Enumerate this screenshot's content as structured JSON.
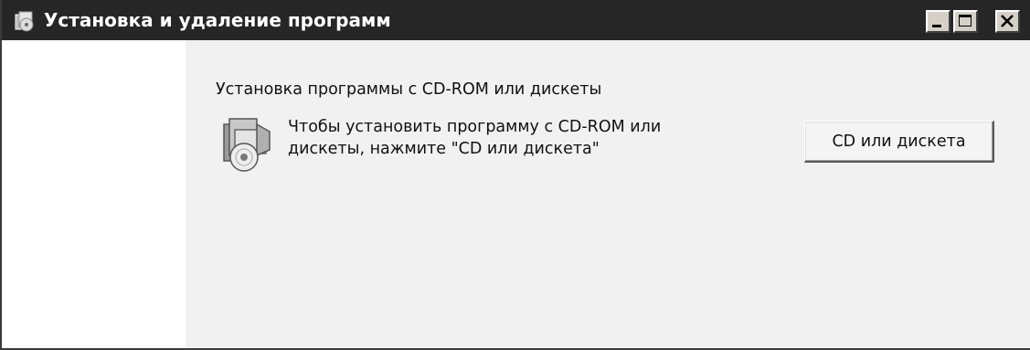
{
  "window": {
    "title": "Установка и удаление программ",
    "title_icon": "add-remove-programs-icon",
    "controls": {
      "minimize_icon": "minimize-icon",
      "maximize_icon": "maximize-icon",
      "close_icon": "close-icon"
    },
    "titlebar_color": "#262626"
  },
  "content": {
    "section_title": "Установка программы с CD-ROM или дискеты",
    "icon": "cd-install-icon",
    "description_line1": "Чтобы установить программу с CD-ROM или",
    "description_line2": "дискеты, нажмите \"CD или дискета\"",
    "button_label": "CD или дискета",
    "background": "#f1f1f1"
  }
}
